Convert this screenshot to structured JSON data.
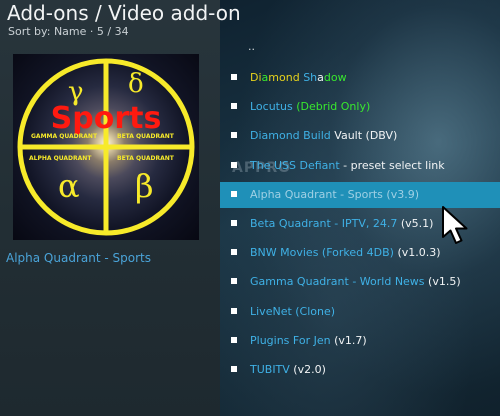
{
  "header": {
    "title": "Add-ons / Video add-on",
    "sort_line": "Sort by: Name",
    "position": "5 / 34"
  },
  "thumbnail": {
    "word": "Sports",
    "quadrants": [
      "GAMMA QUADRANT",
      "BETA QUADRANT",
      "ALPHA QUADRANT",
      "BETA QUADRANT"
    ],
    "glyphs": [
      "γ",
      "δ",
      "α",
      "β"
    ]
  },
  "selected_item_title": "Alpha Quadrant - Sports",
  "list": {
    "parent": "..",
    "items": [
      {
        "segments": [
          {
            "text": "Di",
            "color": "yellow"
          },
          {
            "text": "a",
            "color": "green"
          },
          {
            "text": "mond ",
            "color": "yellow"
          },
          {
            "text": "Sh",
            "color": "blue"
          },
          {
            "text": "a",
            "color": "white"
          },
          {
            "text": "dow",
            "color": "green"
          }
        ]
      },
      {
        "segments": [
          {
            "text": "Locutus",
            "color": "blue"
          },
          {
            "text": " (Debrid Only)",
            "color": "green"
          }
        ]
      },
      {
        "segments": [
          {
            "text": "Diamond Build",
            "color": "blue"
          },
          {
            "text": " Vault (DBV)",
            "color": "white"
          }
        ]
      },
      {
        "segments": [
          {
            "text": "The USS Defiant",
            "color": "blue"
          },
          {
            "text": " - preset select link",
            "color": "white"
          }
        ]
      },
      {
        "selected": true,
        "segments": [
          {
            "text": "Alpha Quadrant - Sports",
            "color": "selected"
          },
          {
            "text": " (v3.9)",
            "color": "selected"
          }
        ]
      },
      {
        "segments": [
          {
            "text": "Beta Quadrant - IPTV, 24.7",
            "color": "blue"
          },
          {
            "text": " (v5.1)",
            "color": "white"
          }
        ]
      },
      {
        "segments": [
          {
            "text": "BNW Movies (Forked 4DB)",
            "color": "blue"
          },
          {
            "text": " (v1.0.3)",
            "color": "white"
          }
        ]
      },
      {
        "segments": [
          {
            "text": "Gamma Quadrant - World News",
            "color": "blue"
          },
          {
            "text": " (v1.5)",
            "color": "white"
          }
        ]
      },
      {
        "segments": [
          {
            "text": "LiveNet (Clone)",
            "color": "blue"
          }
        ]
      },
      {
        "segments": [
          {
            "text": "Plugins For Jen",
            "color": "blue"
          },
          {
            "text": " (v1.7)",
            "color": "white"
          }
        ]
      },
      {
        "segments": [
          {
            "text": "TUBITV",
            "color": "blue"
          },
          {
            "text": " (v2.0)",
            "color": "white"
          }
        ]
      }
    ]
  },
  "background_sign": "APPRO",
  "colors": {
    "accent_blue": "#3fb1e6",
    "selection": "#1f90b8",
    "green": "#38e82e",
    "yellow": "#e6d21c",
    "title_blue": "#4aa3d8"
  },
  "icons": {
    "list_bullet": "square-bullet",
    "cursor": "mouse-pointer-arrow"
  }
}
